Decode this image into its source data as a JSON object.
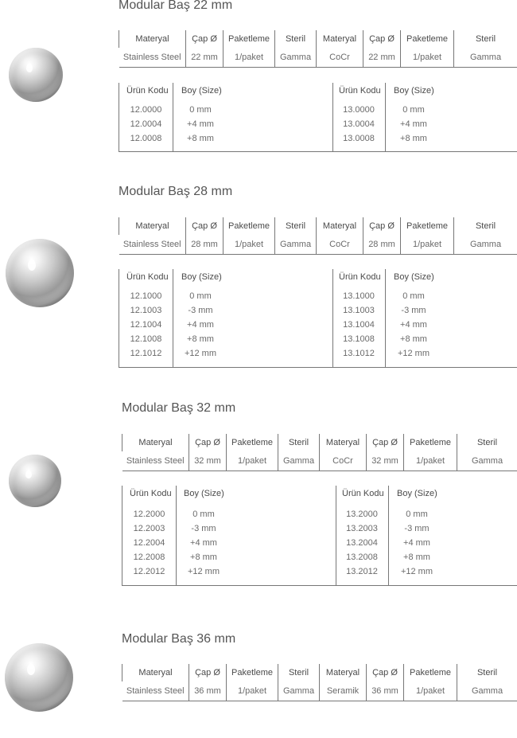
{
  "labels": {
    "materyal": "Materyal",
    "cap": "Çap Ø",
    "paketleme": "Paketleme",
    "steril": "Steril",
    "urun_kodu": "Ürün Kodu",
    "boy": "Boy (Size)"
  },
  "sections": [
    {
      "title": "Modular Baş 22 mm",
      "spec": [
        "Stainless Steel",
        "22 mm",
        "1/paket",
        "Gamma",
        "CoCr",
        "22 mm",
        "1/paket",
        "Gamma"
      ],
      "left_codes": [
        "12.0000",
        "12.0004",
        "12.0008"
      ],
      "left_sizes": [
        "0 mm",
        "+4 mm",
        "+8 mm"
      ],
      "right_codes": [
        "13.0000",
        "13.0004",
        "13.0008"
      ],
      "right_sizes": [
        "0 mm",
        "+4 mm",
        "+8 mm"
      ]
    },
    {
      "title": "Modular Baş 28 mm",
      "spec": [
        "Stainless Steel",
        "28 mm",
        "1/paket",
        "Gamma",
        "CoCr",
        "28 mm",
        "1/paket",
        "Gamma"
      ],
      "left_codes": [
        "12.1000",
        "12.1003",
        "12.1004",
        "12.1008",
        "12.1012"
      ],
      "left_sizes": [
        "0 mm",
        "-3 mm",
        "+4 mm",
        "+8 mm",
        "+12 mm"
      ],
      "right_codes": [
        "13.1000",
        "13.1003",
        "13.1004",
        "13.1008",
        "13.1012"
      ],
      "right_sizes": [
        "0 mm",
        "-3 mm",
        "+4 mm",
        "+8 mm",
        "+12 mm"
      ]
    },
    {
      "title": "Modular Baş 32 mm",
      "spec": [
        "Stainless Steel",
        "32 mm",
        "1/paket",
        "Gamma",
        "CoCr",
        "32 mm",
        "1/paket",
        "Gamma"
      ],
      "left_codes": [
        "12.2000",
        "12.2003",
        "12.2004",
        "12.2008",
        "12.2012"
      ],
      "left_sizes": [
        "0 mm",
        "-3 mm",
        "+4 mm",
        "+8 mm",
        "+12 mm"
      ],
      "right_codes": [
        "13.2000",
        "13.2003",
        "13.2004",
        "13.2008",
        "13.2012"
      ],
      "right_sizes": [
        "0 mm",
        "-3 mm",
        "+4 mm",
        "+8 mm",
        "+12 mm"
      ]
    },
    {
      "title": "Modular Baş 36 mm",
      "spec": [
        "Stainless Steel",
        "36 mm",
        "1/paket",
        "Gamma",
        "Seramik",
        "36 mm",
        "1/paket",
        "Gamma"
      ]
    }
  ]
}
